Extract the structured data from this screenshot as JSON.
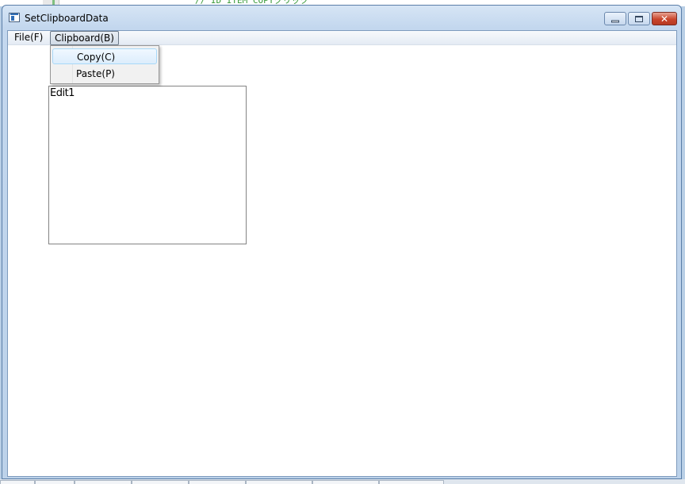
{
  "window": {
    "title": "SetClipboardData",
    "close_symbol": "✕"
  },
  "background": {
    "code_snippet": "// ID_ITEM_COPYクリック"
  },
  "menubar": {
    "items": [
      {
        "label": "File(F)"
      },
      {
        "label": "Clipboard(B)"
      }
    ]
  },
  "dropdown": {
    "items": [
      {
        "label": "Copy(C)",
        "highlighted": true
      },
      {
        "label": "Paste(P)",
        "highlighted": false
      }
    ]
  },
  "editbox": {
    "text": "Edit1"
  },
  "icons": {
    "app": "app-window-icon",
    "minimize": "minimize-icon",
    "maximize": "maximize-icon",
    "close": "close-icon"
  }
}
